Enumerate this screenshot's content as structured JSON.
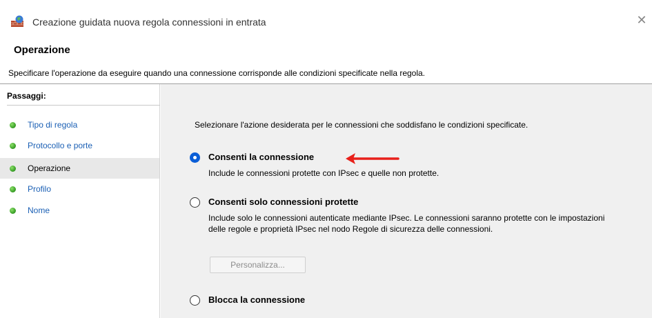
{
  "window": {
    "title": "Creazione guidata nuova regola connessioni in entrata",
    "close_symbol": "✕",
    "icon": "firewall-wizard-icon"
  },
  "header": {
    "title": "Operazione",
    "description": "Specificare l'operazione da eseguire quando una connessione corrisponde alle condizioni specificate nella regola."
  },
  "sidebar": {
    "title": "Passaggi:",
    "steps": [
      {
        "label": "Tipo di regola",
        "active": false
      },
      {
        "label": "Protocollo e porte",
        "active": false
      },
      {
        "label": "Operazione",
        "active": true
      },
      {
        "label": "Profilo",
        "active": false
      },
      {
        "label": "Nome",
        "active": false
      }
    ]
  },
  "main": {
    "instruction": "Selezionare l'azione desiderata per le connessioni che soddisfano le condizioni specificate.",
    "options": [
      {
        "label": "Consenti la connessione",
        "description": "Include le connessioni protette con IPsec e quelle non protette.",
        "checked": true
      },
      {
        "label": "Consenti solo connessioni protette",
        "description": "Include solo le connessioni autenticate mediante IPsec. Le connessioni saranno protette con le impostazioni delle regole e proprietà IPsec nel nodo Regole di sicurezza delle connessioni.",
        "checked": false
      },
      {
        "label": "Blocca la connessione",
        "description": "",
        "checked": false
      }
    ],
    "customize_button": "Personalizza...",
    "annotation_color": "#e8201a",
    "accent_color": "#0b5ed7"
  }
}
